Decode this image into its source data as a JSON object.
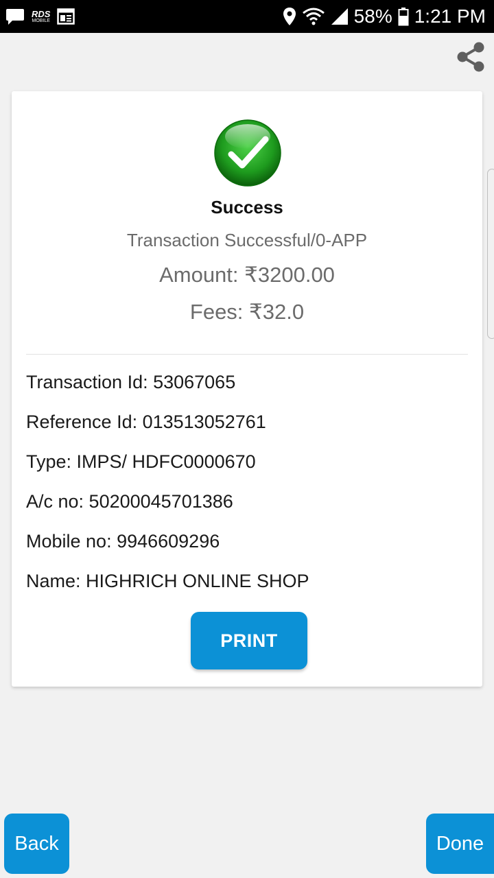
{
  "status_bar": {
    "rds_logo_text": "RDS",
    "rds_logo_subtext": "MOBILE",
    "battery_percent": "58%",
    "time": "1:21 PM"
  },
  "result": {
    "status_title": "Success",
    "message": "Transaction Successful/0-APP",
    "amount": "Amount: ₹3200.00",
    "fees": "Fees: ₹32.0"
  },
  "details": [
    "Transaction Id: 53067065",
    "Reference Id: 013513052761",
    "Type: IMPS/ HDFC0000670",
    "A/c no: 50200045701386",
    "Mobile no: 9946609296",
    "Name: HIGHRICH ONLINE SHOP"
  ],
  "buttons": {
    "print": "PRINT",
    "back": "Back",
    "done": "Done"
  },
  "colors": {
    "accent": "#0c91d6",
    "success_green": "#1e9b1e",
    "background": "#f1f1f1"
  },
  "icons": {
    "share": "share-icon",
    "success": "success-check-icon",
    "message": "message-icon",
    "calendar": "calendar-icon",
    "location": "location-icon",
    "wifi": "wifi-icon",
    "signal": "signal-icon",
    "battery": "battery-icon"
  }
}
